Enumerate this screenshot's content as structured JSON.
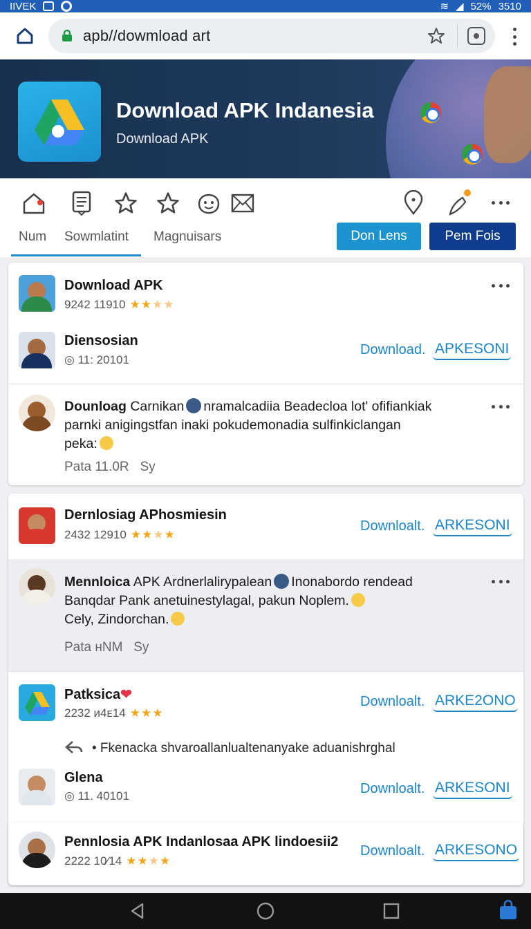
{
  "status": {
    "left_text": "IIVEK",
    "battery": "52%",
    "time": "3510"
  },
  "browser": {
    "url": "apb//dowmload art"
  },
  "banner": {
    "title": "Download APK Indanesia",
    "subtitle": "Download APK"
  },
  "tabs": [
    {
      "label": "Num",
      "active": true
    },
    {
      "label": "Sowmlatint",
      "active": false
    },
    {
      "label": "Magnuisars",
      "active": false
    }
  ],
  "actions": {
    "lens": "Don Lens",
    "fois": "Pem Fois"
  },
  "feed": {
    "r1": {
      "title": "Download APK",
      "meta": "9242 11910",
      "stars": "★★",
      "stars_dim": "★★"
    },
    "r2": {
      "title": "Diensosian",
      "meta": "◎ 11: 20101",
      "dl": "Download.",
      "apk": "APKESONI"
    },
    "post1": {
      "author": "Dounloag",
      "line1": "Carnikan",
      "line1b": "nramalcadiia Beadecloa lot' ofifiankiak",
      "line2": "parnki anigingstfan inaki pokudemonadia sulfinkiclangan",
      "line3": "peka:",
      "foot": "Pata 11.0R",
      "foot_b": "Sy"
    },
    "r3": {
      "title": "Dernlosiag APhosmiesin",
      "meta": "2432 12910",
      "stars": "★★",
      "stars_dim": "★",
      "stars2": "★",
      "dl": "Downloalt.",
      "apk": "ARKESONI"
    },
    "post2": {
      "author": "Mennloica",
      "line1": "APK Ardnerlalirypalean",
      "line1b": "Inonabordo rendead",
      "line2": "Banqdar Pank anetuinestylagal, pakun Noplem.",
      "line3": "Cely, Zindorchan.",
      "foot": "Pata нNM",
      "foot_b": "Sy"
    },
    "r4": {
      "title": "Patksica",
      "meta": "2232 ᴎ4ᴇ14",
      "stars": "★★★",
      "dl": "Downloalt.",
      "apk": "ARKE2ONO"
    },
    "share": "• Fkenacka shvaroallanlualtenanyake aduanishrghal",
    "r5": {
      "title": "Glena",
      "meta": "◎ 11. 40101",
      "dl": "Downloalt.",
      "apk": "ARKESONI"
    },
    "r6": {
      "title": "Pennlosia APK Indanlosaa APK lindoesii2",
      "meta": "2222 10⁄14",
      "stars": "★★",
      "stars_dim": "★",
      "stars2": "★",
      "dl": "Downloalt.",
      "apk": "ARKESONO"
    }
  },
  "colors": {
    "accent": "#1b85c8",
    "status_bar": "#1f5fb8",
    "banner": "#1e3a5c",
    "primary_button": "#0f3c8c"
  }
}
